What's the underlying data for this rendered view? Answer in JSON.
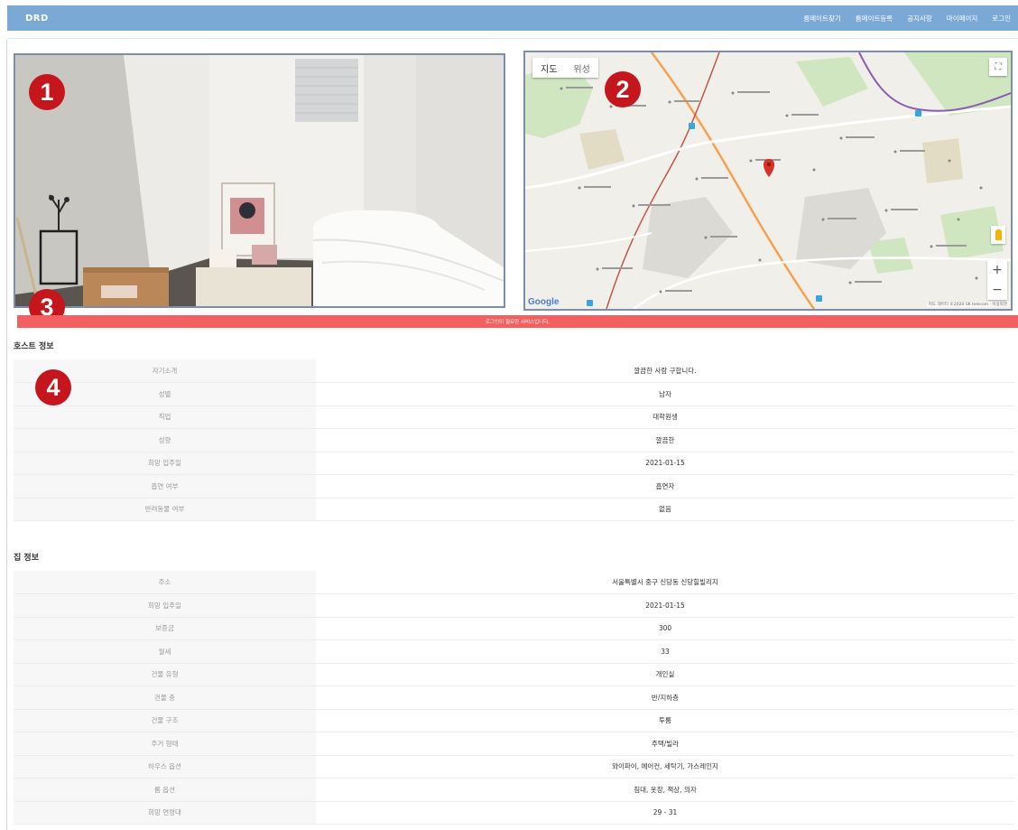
{
  "navbar": {
    "brand": "DRD",
    "links": [
      "룸메이트찾기",
      "룸메이트등록",
      "공지사항",
      "마이페이지",
      "로그인"
    ],
    "color": "#7ba9d6"
  },
  "map": {
    "type_buttons": [
      "지도",
      "위성"
    ],
    "logo": "Google",
    "attribution": "지도 데이터 ©2020 SK telecom · 이용약관",
    "zoom_in": "+",
    "zoom_out": "−"
  },
  "markers": [
    "1",
    "2",
    "3",
    "4"
  ],
  "marker_color": "#c4161c",
  "alert": {
    "text": "로그인이 필요한 서비스입니다.",
    "color": "#f3605f"
  },
  "host": {
    "title": "호스트 정보",
    "rows": [
      {
        "label": "자기소개",
        "value": "깔끔한 사람 구합니다."
      },
      {
        "label": "성별",
        "value": "남자"
      },
      {
        "label": "직업",
        "value": "대학원생"
      },
      {
        "label": "성향",
        "value": "깔끔한"
      },
      {
        "label": "희망 입주일",
        "value": "2021-01-15"
      },
      {
        "label": "흡연 여부",
        "value": "흡연자"
      },
      {
        "label": "반려동물 여부",
        "value": "없음"
      }
    ]
  },
  "house": {
    "title": "집 정보",
    "rows": [
      {
        "label": "주소",
        "value": "서울특별시 중구 신당동 신당힐빌리지"
      },
      {
        "label": "희망 입주일",
        "value": "2021-01-15"
      },
      {
        "label": "보증금",
        "value": "300"
      },
      {
        "label": "월세",
        "value": "33"
      },
      {
        "label": "건물 유형",
        "value": "개인실"
      },
      {
        "label": "건물 층",
        "value": "반/지하층"
      },
      {
        "label": "건물 구조",
        "value": "투룸"
      },
      {
        "label": "주거 형태",
        "value": "주택/빌라"
      },
      {
        "label": "하우스 옵션",
        "value": "와이파이, 에어컨, 세탁기, 가스레인지"
      },
      {
        "label": "룸 옵션",
        "value": "침대, 옷장, 책상, 의자"
      },
      {
        "label": "희망 연령대",
        "value": "29 - 31"
      }
    ]
  }
}
